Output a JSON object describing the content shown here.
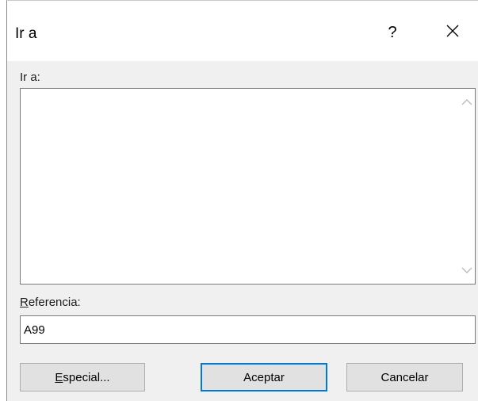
{
  "dialog": {
    "title": "Ir a",
    "help_label": "?",
    "close_icon": "close-icon"
  },
  "goto_list": {
    "label": "Ir a:",
    "items": [],
    "scroll_up_icon": "chevron-up-icon",
    "scroll_down_icon": "chevron-down-icon"
  },
  "reference": {
    "label_first": "R",
    "label_rest": "eferencia:",
    "value": "A99"
  },
  "buttons": {
    "especial_first": "E",
    "especial_rest": "special...",
    "aceptar": "Aceptar",
    "cancelar": "Cancelar"
  },
  "colors": {
    "accent_border": "#0078d7",
    "dialog_background": "#f0f0f0"
  }
}
